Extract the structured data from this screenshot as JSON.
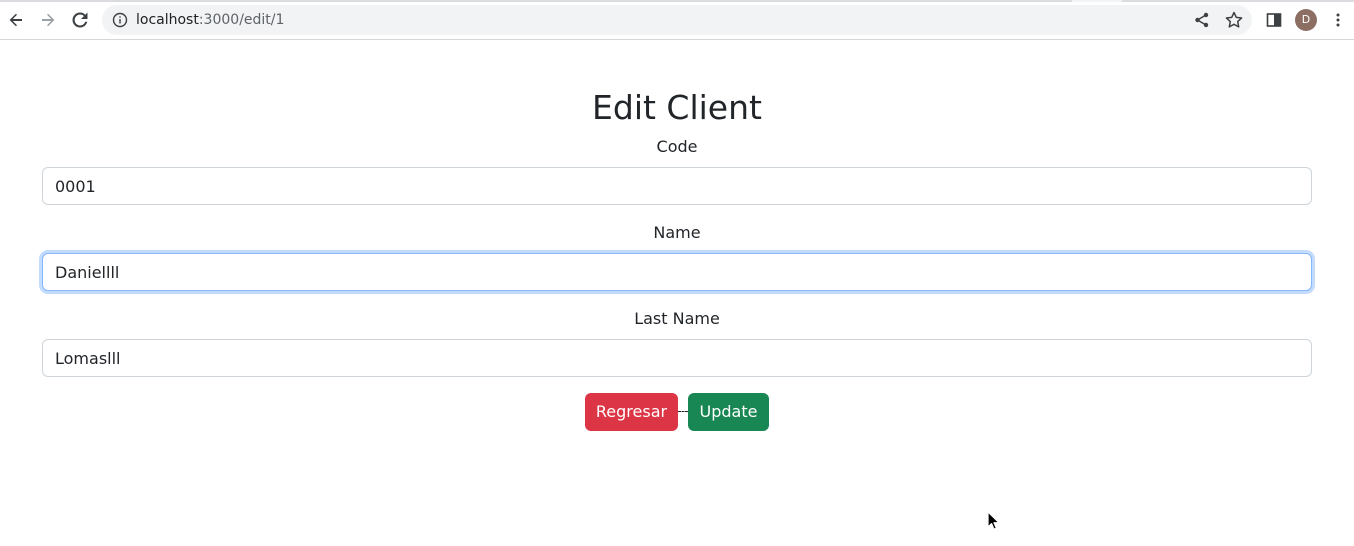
{
  "browser": {
    "url_host": "localhost",
    "url_path": ":3000/edit/1",
    "profile_initial": "D",
    "icons": [
      "back-icon",
      "forward-icon",
      "reload-icon",
      "info-icon",
      "share-icon",
      "star-icon",
      "side-panel-icon",
      "menu-icon"
    ]
  },
  "page": {
    "title": "Edit Client"
  },
  "form": {
    "code_label": "Code",
    "code_value": "0001",
    "name_label": "Name",
    "name_value": "Daniellll",
    "last_name_label": "Last Name",
    "last_name_value": "Lomaslll",
    "back_label": "Regresar",
    "update_label": "Update"
  },
  "colors": {
    "danger": "#dc3545",
    "success": "#198754",
    "focus_border": "#86b7fe"
  }
}
